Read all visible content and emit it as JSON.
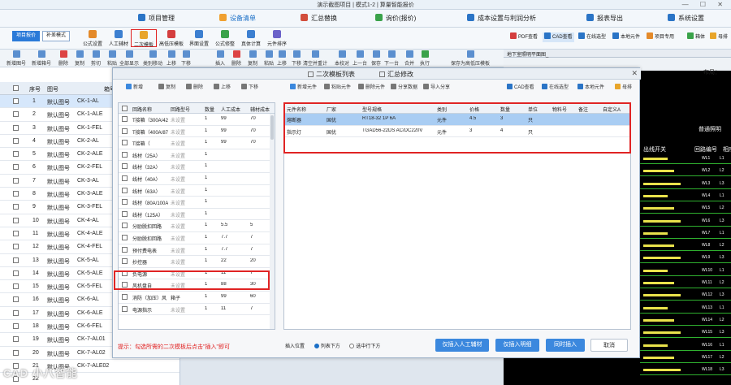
{
  "window": {
    "title": "演示截图项目 | 模式1-2 | 算量智能报价"
  },
  "menu": [
    {
      "label": "项目管理",
      "icon": "project-icon",
      "color": "#2a74c6"
    },
    {
      "label": "设备清单",
      "icon": "list-icon",
      "color": "#f0a030"
    },
    {
      "label": "汇总替换",
      "icon": "summary-icon",
      "color": "#d24d3b"
    },
    {
      "label": "询价(报价)",
      "icon": "quote-icon",
      "color": "#3aa24a"
    },
    {
      "label": "成本设置与利润分析",
      "icon": "cost-icon",
      "color": "#2a74c6"
    },
    {
      "label": "报表导出",
      "icon": "report-icon",
      "color": "#2a74c6"
    },
    {
      "label": "系统设置",
      "icon": "settings-icon",
      "color": "#2a74c6"
    }
  ],
  "ribbon": {
    "mode_tabs": [
      "项目报价",
      "补差模式"
    ],
    "buttons": [
      "公式设置",
      "人工辅材",
      "二次模板",
      "高低压模板",
      "界面设置",
      "公式修整",
      "真体计算",
      "元件排序"
    ],
    "right": [
      "PDF查看",
      "CAD查看",
      "在线选型",
      "本地元件",
      "项目专用",
      "箱体",
      "母排"
    ]
  },
  "toolbar": [
    "新增图号",
    "新增箱号",
    "删除",
    "复制",
    "剪切",
    "粘贴",
    "全部显示",
    "类别移动",
    "上移",
    "下移",
    "插入",
    "删除",
    "复制",
    "粘贴",
    "上移",
    "下移",
    "清空并重计",
    "本校对",
    "上一台",
    "保存",
    "下一台",
    "合并",
    "执行",
    "保存为高低压模板"
  ],
  "left_table": {
    "headers": [
      "序号",
      "图号",
      "箱号"
    ],
    "rows": [
      {
        "n": "1",
        "figure": "默认图号",
        "box": "CK-1-AL"
      },
      {
        "n": "2",
        "figure": "默认图号",
        "box": "CK-1-ALE"
      },
      {
        "n": "3",
        "figure": "默认图号",
        "box": "CK-1-FEL"
      },
      {
        "n": "4",
        "figure": "默认图号",
        "box": "CK-2-AL"
      },
      {
        "n": "5",
        "figure": "默认图号",
        "box": "CK-2-ALE"
      },
      {
        "n": "6",
        "figure": "默认图号",
        "box": "CK-2-FEL"
      },
      {
        "n": "7",
        "figure": "默认图号",
        "box": "CK-3-AL"
      },
      {
        "n": "8",
        "figure": "默认图号",
        "box": "CK-3-ALE"
      },
      {
        "n": "9",
        "figure": "默认图号",
        "box": "CK-3-FEL"
      },
      {
        "n": "10",
        "figure": "默认图号",
        "box": "CK-4-AL"
      },
      {
        "n": "11",
        "figure": "默认图号",
        "box": "CK-4-ALE"
      },
      {
        "n": "12",
        "figure": "默认图号",
        "box": "CK-4-FEL"
      },
      {
        "n": "13",
        "figure": "默认图号",
        "box": "CK-5-AL"
      },
      {
        "n": "14",
        "figure": "默认图号",
        "box": "CK-5-ALE"
      },
      {
        "n": "15",
        "figure": "默认图号",
        "box": "CK-5-FEL"
      },
      {
        "n": "16",
        "figure": "默认图号",
        "box": "CK-6-AL"
      },
      {
        "n": "17",
        "figure": "默认图号",
        "box": "CK-6-ALE"
      },
      {
        "n": "18",
        "figure": "默认图号",
        "box": "CK-6-FEL"
      },
      {
        "n": "19",
        "figure": "默认图号",
        "box": "CK-7-AL01"
      },
      {
        "n": "20",
        "figure": "默认图号",
        "box": "CK-7-AL02"
      },
      {
        "n": "21",
        "figure": "默认图号",
        "box": "CK-7-ALE02"
      },
      {
        "n": "22",
        "figure": "",
        "box": ""
      }
    ]
  },
  "dialog": {
    "tabs": [
      "二次模板列表",
      "汇总修改"
    ],
    "left_tools": [
      "新增",
      "复制",
      "删除",
      "上移",
      "下移"
    ],
    "right_tools": [
      "新增元件",
      "粘贴元件",
      "删除元件",
      "分享数据",
      "导入分享"
    ],
    "right_tools2": [
      "CAD查看",
      "在线选型",
      "本地元件",
      "母排"
    ],
    "left_headers": [
      "回路名称",
      "回路型号",
      "数量",
      "人工成本",
      "辅材成本"
    ],
    "left_rows": [
      {
        "name": "T接箱（300A/420",
        "model": "未设置",
        "qty": "1",
        "labor": "99",
        "aux": "70"
      },
      {
        "name": "T接箱（400A/8720",
        "model": "未设置",
        "qty": "1",
        "labor": "99",
        "aux": "70"
      },
      {
        "name": "T接箱（",
        "model": "未设置",
        "qty": "1",
        "labor": "99",
        "aux": "70"
      },
      {
        "name": "线材（25A）",
        "model": "未设置",
        "qty": "1",
        "labor": "",
        "aux": ""
      },
      {
        "name": "线材（32A）",
        "model": "未设置",
        "qty": "1",
        "labor": "",
        "aux": ""
      },
      {
        "name": "线材（40A）",
        "model": "未设置",
        "qty": "1",
        "labor": "",
        "aux": ""
      },
      {
        "name": "线材（63A）",
        "model": "未设置",
        "qty": "1",
        "labor": "",
        "aux": ""
      },
      {
        "name": "线材（80A/100A）",
        "model": "未设置",
        "qty": "1",
        "labor": "",
        "aux": ""
      },
      {
        "name": "线材（125A）",
        "model": "未设置",
        "qty": "1",
        "labor": "",
        "aux": ""
      },
      {
        "name": "分励脱扣回路",
        "model": "未设置",
        "qty": "1",
        "labor": "5.5",
        "aux": "5"
      },
      {
        "name": "分励脱扣回路",
        "model": "未设置",
        "qty": "1",
        "labor": "7.7",
        "aux": "7"
      },
      {
        "name": "预付费电表",
        "model": "未设置",
        "qty": "1",
        "labor": "7.7",
        "aux": "7"
      },
      {
        "name": "抄控器",
        "model": "未设置",
        "qty": "1",
        "labor": "22",
        "aux": "20"
      },
      {
        "name": "负电源",
        "model": "未设置",
        "qty": "1",
        "labor": "11",
        "aux": "7"
      },
      {
        "name": "风机盘自",
        "model": "未设置",
        "qty": "1",
        "labor": "88",
        "aux": "30"
      },
      {
        "name": "消防（加压）风",
        "model": "箱子",
        "qty": "1",
        "labor": "99",
        "aux": "60"
      },
      {
        "name": "电源指示",
        "model": "未设置",
        "qty": "1",
        "labor": "11",
        "aux": "7"
      }
    ],
    "right_headers": [
      "元件名称",
      "厂家",
      "型号规格",
      "类别",
      "价格",
      "数量",
      "单位",
      "物料号",
      "备注",
      "自定义A"
    ],
    "right_rows": [
      {
        "name": "熔断器",
        "brand": "国优",
        "model": "RT18-32 1P 6A",
        "type": "元件",
        "price": "4.5",
        "qty": "3",
        "unit": "只"
      },
      {
        "name": "指示灯",
        "brand": "国优",
        "model": "TGAD56-22DS AC/DC220V",
        "type": "元件",
        "price": "3",
        "qty": "4",
        "unit": "只"
      }
    ],
    "hint": "提示：勾选所需的二次模板后点击\"插入\"即可",
    "insert_position": "插入位置",
    "radio_options": [
      "列表下方",
      "选中行下方"
    ],
    "buttons": [
      "仅插入人工辅材",
      "仅插入明细",
      "同时插入",
      "取消"
    ]
  },
  "cad": {
    "tab": "地下室照明平面图_",
    "layout_label": "布局：",
    "headers": [
      "出线开关",
      "回路编号",
      "相序"
    ],
    "panel_title": "普通照明",
    "codes": [
      "WL1",
      "WL2",
      "WL3",
      "WL4",
      "WL5",
      "WL6",
      "WL7",
      "WL8",
      "WL9",
      "WL10",
      "WL11",
      "WL12",
      "WL13",
      "WL14",
      "WL15",
      "WL16",
      "WL17",
      "WL18"
    ],
    "phases": [
      "L1",
      "L2",
      "L3",
      "L1",
      "L2",
      "L3",
      "L1",
      "L2",
      "L3",
      "L1",
      "L2",
      "L3",
      "L1",
      "L2",
      "L3",
      "L1",
      "L2",
      "L3"
    ]
  },
  "watermark": "CAD 小八智能"
}
